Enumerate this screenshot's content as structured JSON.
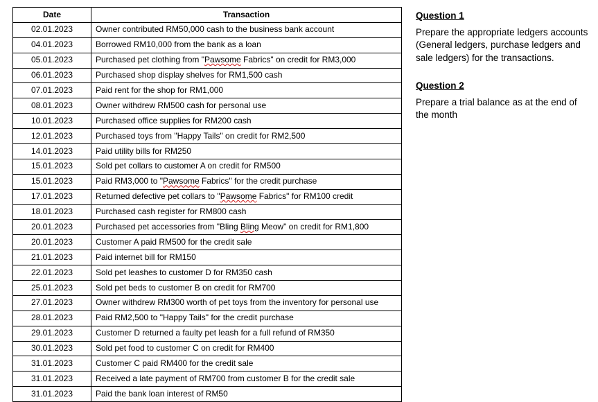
{
  "table": {
    "headers": {
      "date": "Date",
      "transaction": "Transaction"
    },
    "rows": [
      {
        "date": "02.01.2023",
        "parts": [
          {
            "t": "Owner contributed RM50,000 cash to the business bank account"
          }
        ]
      },
      {
        "date": "04.01.2023",
        "parts": [
          {
            "t": "Borrowed RM10,000 from the bank as a loan"
          }
        ]
      },
      {
        "date": "05.01.2023",
        "parts": [
          {
            "t": "Purchased pet clothing from \""
          },
          {
            "t": "Pawsome",
            "spell": true
          },
          {
            "t": " Fabrics\" on credit for RM3,000"
          }
        ]
      },
      {
        "date": "06.01.2023",
        "parts": [
          {
            "t": "Purchased shop display shelves for RM1,500 cash"
          }
        ]
      },
      {
        "date": "07.01.2023",
        "parts": [
          {
            "t": "Paid rent for the shop for RM1,000"
          }
        ]
      },
      {
        "date": "08.01.2023",
        "parts": [
          {
            "t": "Owner withdrew RM500 cash for personal use"
          }
        ]
      },
      {
        "date": "10.01.2023",
        "parts": [
          {
            "t": "Purchased office supplies for RM200 cash"
          }
        ]
      },
      {
        "date": "12.01.2023",
        "parts": [
          {
            "t": "Purchased toys from \"Happy Tails\" on credit for RM2,500"
          }
        ]
      },
      {
        "date": "14.01.2023",
        "parts": [
          {
            "t": "Paid utility bills for RM250"
          }
        ]
      },
      {
        "date": "15.01.2023",
        "parts": [
          {
            "t": "Sold pet collars to customer A on credit for RM500"
          }
        ]
      },
      {
        "date": "15.01.2023",
        "parts": [
          {
            "t": "Paid RM3,000 to \""
          },
          {
            "t": "Pawsome",
            "spell": true
          },
          {
            "t": " Fabrics\" for the credit purchase"
          }
        ]
      },
      {
        "date": "17.01.2023",
        "parts": [
          {
            "t": "Returned defective pet collars to \""
          },
          {
            "t": "Pawsome",
            "spell": true
          },
          {
            "t": " Fabrics\" for RM100 credit"
          }
        ]
      },
      {
        "date": "18.01.2023",
        "parts": [
          {
            "t": "Purchased cash register for RM800 cash"
          }
        ]
      },
      {
        "date": "20.01.2023",
        "parts": [
          {
            "t": "Purchased pet accessories from \"Bling "
          },
          {
            "t": "Bling",
            "spell": true
          },
          {
            "t": " Meow\" on credit for RM1,800"
          }
        ]
      },
      {
        "date": "20.01.2023",
        "parts": [
          {
            "t": "Customer A paid RM500 for the credit sale"
          }
        ]
      },
      {
        "date": "21.01.2023",
        "parts": [
          {
            "t": "Paid internet bill for RM150"
          }
        ]
      },
      {
        "date": "22.01.2023",
        "parts": [
          {
            "t": "Sold pet leashes to customer D for RM350 cash"
          }
        ]
      },
      {
        "date": "25.01.2023",
        "parts": [
          {
            "t": "Sold pet beds to customer B on credit for RM700"
          }
        ]
      },
      {
        "date": "27.01.2023",
        "parts": [
          {
            "t": "Owner withdrew RM300 worth of pet toys from the inventory for personal use"
          }
        ]
      },
      {
        "date": "28.01.2023",
        "parts": [
          {
            "t": "Paid RM2,500 to \"Happy Tails\" for the credit purchase"
          }
        ]
      },
      {
        "date": "29.01.2023",
        "parts": [
          {
            "t": "Customer D returned a faulty pet leash for a full refund of RM350"
          }
        ]
      },
      {
        "date": "30.01.2023",
        "parts": [
          {
            "t": "Sold pet food to customer C on credit for RM400"
          }
        ]
      },
      {
        "date": "31.01.2023",
        "parts": [
          {
            "t": "Customer C paid RM400 for the credit sale"
          }
        ]
      },
      {
        "date": "31.01.2023",
        "parts": [
          {
            "t": "Received a late payment of RM700 from customer B for the credit sale"
          }
        ]
      },
      {
        "date": "31.01.2023",
        "parts": [
          {
            "t": "Paid the bank loan interest of RM50"
          }
        ]
      }
    ]
  },
  "questions": {
    "q1_title": "Question 1",
    "q1_body": "Prepare the appropriate ledgers accounts (General ledgers, purchase ledgers and sale ledgers) for the transactions.",
    "q2_title": "Question 2",
    "q2_body": "Prepare a trial balance as at the end of the month"
  }
}
